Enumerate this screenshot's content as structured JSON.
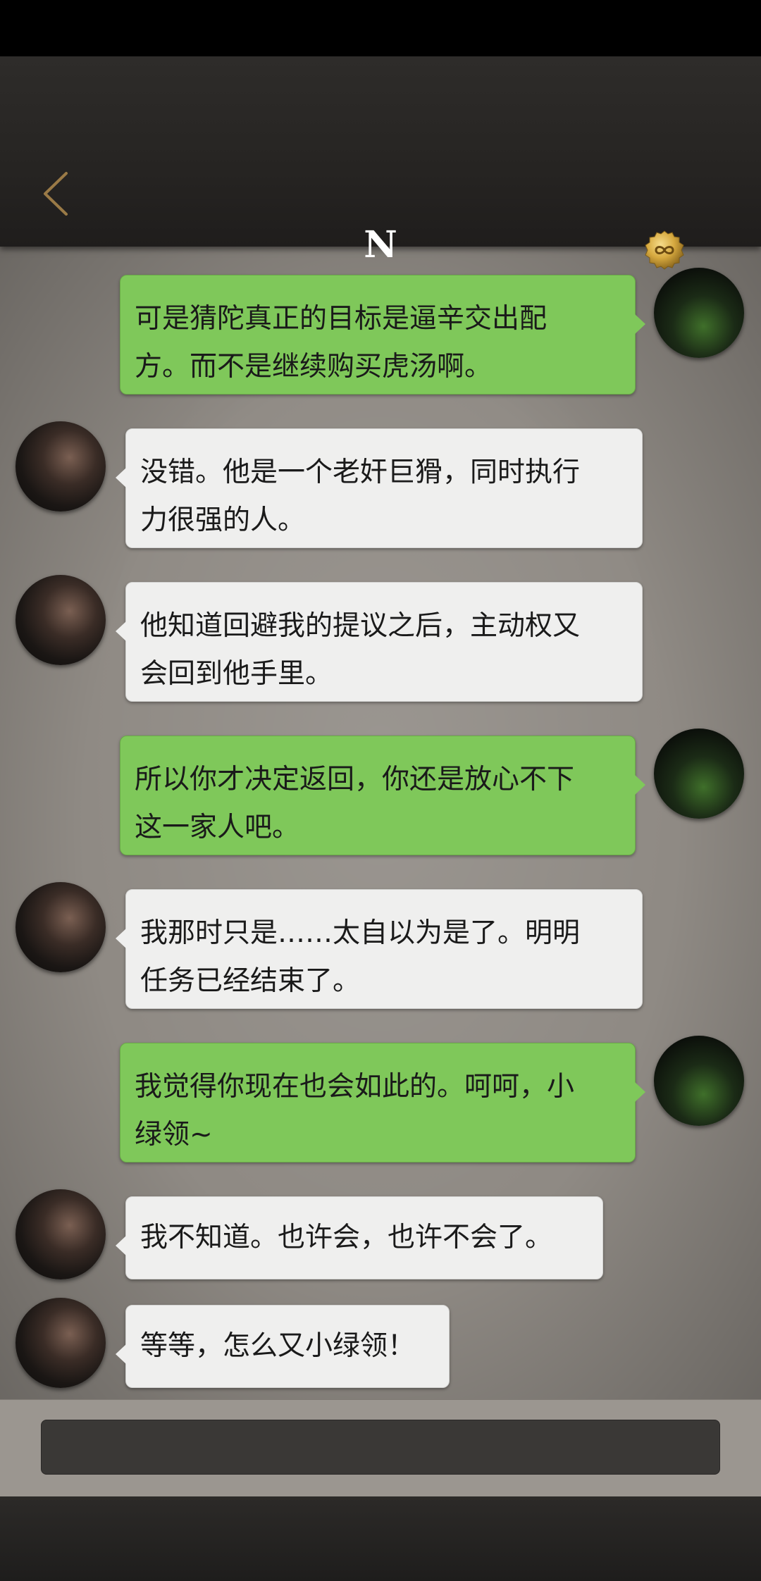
{
  "header": {
    "title": "N",
    "back_icon": "chevron-left-icon",
    "badge_icon": "infinity-seal-icon",
    "accent_color": "#9a7a46"
  },
  "messages": [
    {
      "sender": "self",
      "lines": [
        "可是猜陀真正的目标是逼辛交出配",
        "方。而不是继续购买虎汤啊。"
      ]
    },
    {
      "sender": "npc",
      "lines": [
        "没错。他是一个老奸巨猾，同时执行",
        "力很强的人。"
      ]
    },
    {
      "sender": "npc",
      "lines": [
        "他知道回避我的提议之后，主动权又",
        "会回到他手里。"
      ]
    },
    {
      "sender": "self",
      "lines": [
        "所以你才决定返回，你还是放心不下",
        "这一家人吧。"
      ]
    },
    {
      "sender": "npc",
      "lines": [
        "我那时只是……太自以为是了。明明",
        "任务已经结束了。"
      ]
    },
    {
      "sender": "self",
      "lines": [
        "我觉得你现在也会如此的。呵呵，小",
        "绿领~"
      ]
    },
    {
      "sender": "npc",
      "lines": [
        "我不知道。也许会，也许不会了。"
      ]
    },
    {
      "sender": "npc",
      "lines": [
        "等等，怎么又小绿领！"
      ]
    }
  ],
  "input": {
    "placeholder": ""
  },
  "colors": {
    "outgoing_bubble": "#7fc85a",
    "incoming_bubble": "#efefee"
  }
}
